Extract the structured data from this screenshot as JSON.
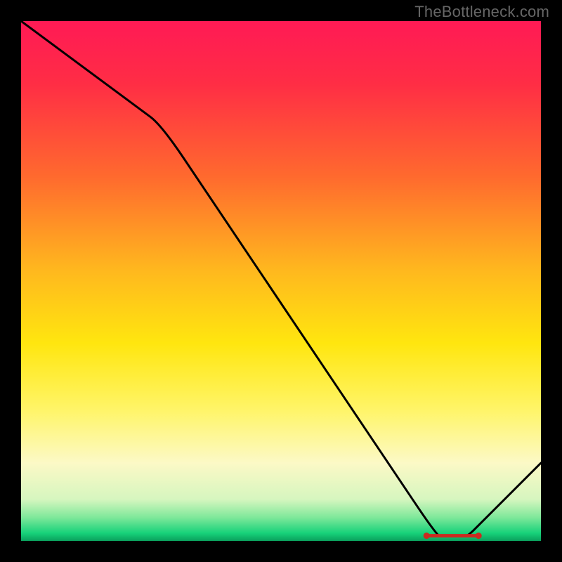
{
  "watermark": "TheBottleneck.com",
  "chart_data": {
    "type": "line",
    "title": "",
    "xlabel": "",
    "ylabel": "",
    "xlim": [
      0,
      100
    ],
    "ylim": [
      0,
      100
    ],
    "x": [
      0,
      27,
      80,
      86,
      100
    ],
    "y": [
      100,
      80,
      1,
      1,
      15
    ],
    "curve_color": "#000000",
    "marker_segment": {
      "x0": 78,
      "x1": 88,
      "y": 1,
      "color": "#cc2a20"
    },
    "background_gradient": {
      "stops": [
        {
          "offset": 0.0,
          "color": "#ff1a55"
        },
        {
          "offset": 0.12,
          "color": "#ff2d45"
        },
        {
          "offset": 0.3,
          "color": "#ff6a2e"
        },
        {
          "offset": 0.48,
          "color": "#ffb81e"
        },
        {
          "offset": 0.62,
          "color": "#ffe60f"
        },
        {
          "offset": 0.75,
          "color": "#fff56a"
        },
        {
          "offset": 0.85,
          "color": "#fcf9c6"
        },
        {
          "offset": 0.92,
          "color": "#d6f6bf"
        },
        {
          "offset": 0.955,
          "color": "#7ee89a"
        },
        {
          "offset": 0.985,
          "color": "#17d27a"
        },
        {
          "offset": 1.0,
          "color": "#0aa05c"
        }
      ]
    }
  }
}
